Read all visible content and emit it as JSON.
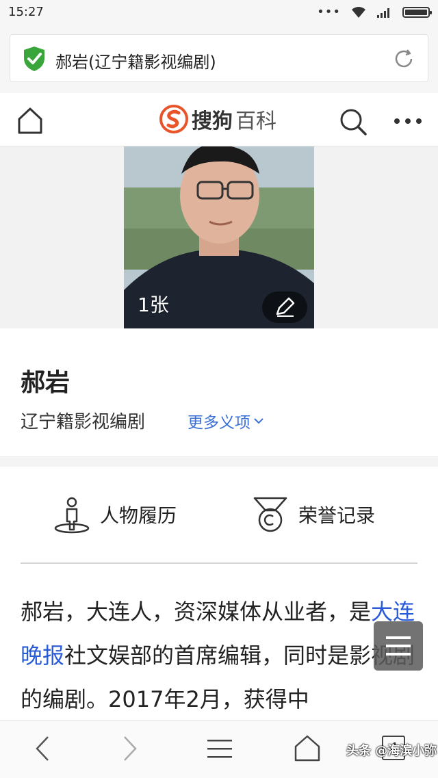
{
  "status": {
    "time": "15:27",
    "dots": "•••"
  },
  "urlbar": {
    "title": "郝岩(辽宁籍影视编剧)"
  },
  "header": {
    "logo_main": "搜狗",
    "logo_sub": "百科"
  },
  "photo": {
    "count_label": "1张"
  },
  "entry": {
    "name": "郝岩",
    "description": "辽宁籍影视编剧",
    "more_meanings": "更多义项"
  },
  "tabs": [
    {
      "label": "人物履历"
    },
    {
      "label": "荣誉记录"
    }
  ],
  "article": {
    "part1": "郝岩，大连人，资深媒体从业者，是",
    "link": "大连晚报",
    "part2": "社文娱部的首席编辑，同时是影视剧的编剧。2017年2月，获得中"
  },
  "bottomnav": {
    "tab_count": "4"
  },
  "watermark": "头条 @海滨小弥",
  "colors": {
    "link": "#2a5bd7",
    "logo_red": "#e8552a",
    "shield_green": "#3aa53a"
  }
}
